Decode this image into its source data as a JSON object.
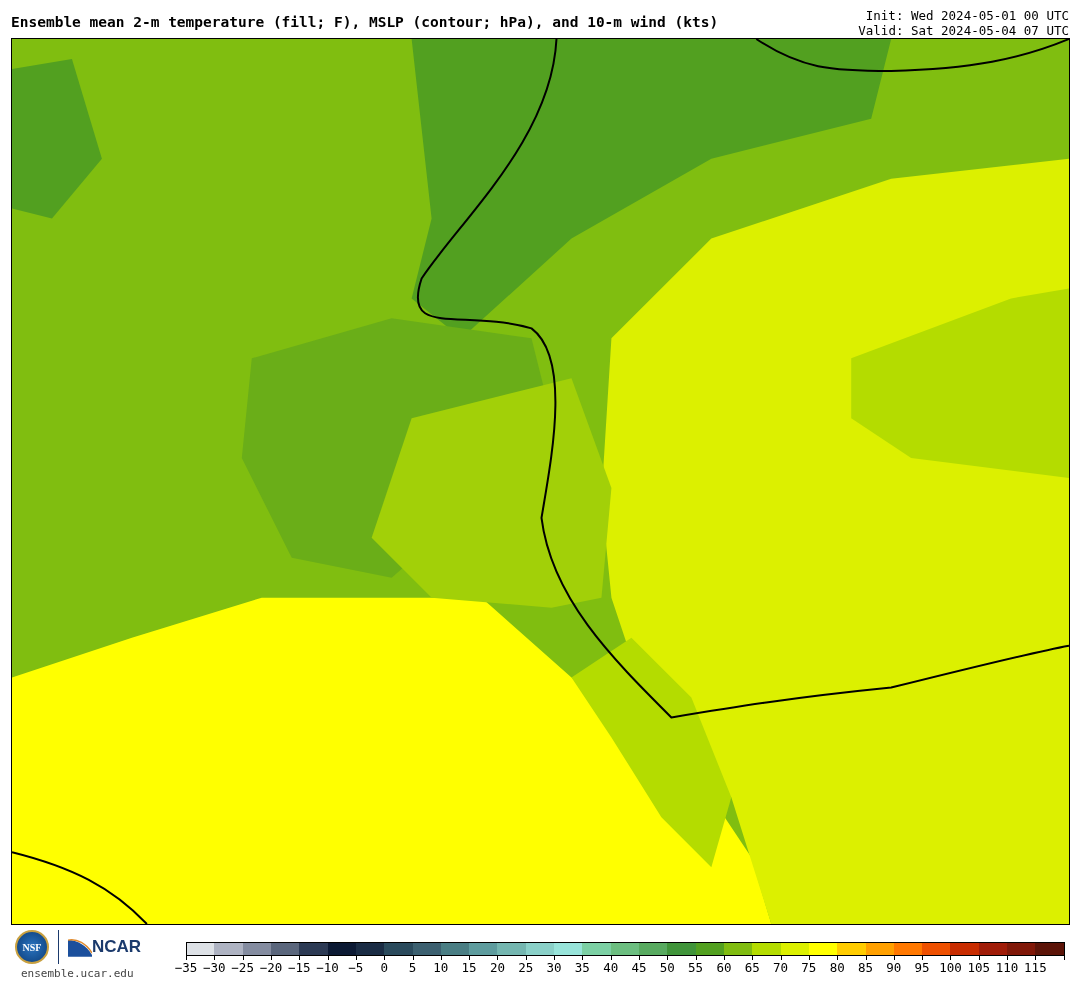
{
  "title": "Ensemble mean 2-m temperature (fill; F), MSLP (contour; hPa), and 10-m wind (kts)",
  "init": "Init: Wed 2024-05-01 00 UTC",
  "valid": "Valid: Sat 2024-05-04 07 UTC",
  "footer": {
    "seal_text": "NSF",
    "logo_text": "NCAR",
    "site": "ensemble.ucar.edu"
  },
  "colorbar": [
    {
      "label": "−35",
      "color": "#dde1e6"
    },
    {
      "label": "−30",
      "color": "#aeb3c2"
    },
    {
      "label": "−25",
      "color": "#848ca0"
    },
    {
      "label": "−20",
      "color": "#5a667c"
    },
    {
      "label": "−15",
      "color": "#2c3a54"
    },
    {
      "label": "−10",
      "color": "#0c1a34"
    },
    {
      "label": "−5",
      "color": "#1a2c44"
    },
    {
      "label": "0",
      "color": "#2a4a5c"
    },
    {
      "label": "5",
      "color": "#3c6070"
    },
    {
      "label": "10",
      "color": "#4a7e84"
    },
    {
      "label": "15",
      "color": "#5e9c9e"
    },
    {
      "label": "20",
      "color": "#74b6b0"
    },
    {
      "label": "25",
      "color": "#8ad0c8"
    },
    {
      "label": "30",
      "color": "#98e4da"
    },
    {
      "label": "35",
      "color": "#7cd0a4"
    },
    {
      "label": "40",
      "color": "#6cbe80"
    },
    {
      "label": "45",
      "color": "#58aa60"
    },
    {
      "label": "50",
      "color": "#40943a"
    },
    {
      "label": "55",
      "color": "#52a020"
    },
    {
      "label": "60",
      "color": "#80bc10"
    },
    {
      "label": "65",
      "color": "#b4dc00"
    },
    {
      "label": "70",
      "color": "#dcf000"
    },
    {
      "label": "75",
      "color": "#ffff00"
    },
    {
      "label": "80",
      "color": "#ffcc00"
    },
    {
      "label": "85",
      "color": "#ffa000"
    },
    {
      "label": "90",
      "color": "#ff7800"
    },
    {
      "label": "95",
      "color": "#ee5000"
    },
    {
      "label": "100",
      "color": "#c82c00"
    },
    {
      "label": "105",
      "color": "#a01c08"
    },
    {
      "label": "110",
      "color": "#801808"
    },
    {
      "label": "115",
      "color": "#5c1408"
    }
  ]
}
